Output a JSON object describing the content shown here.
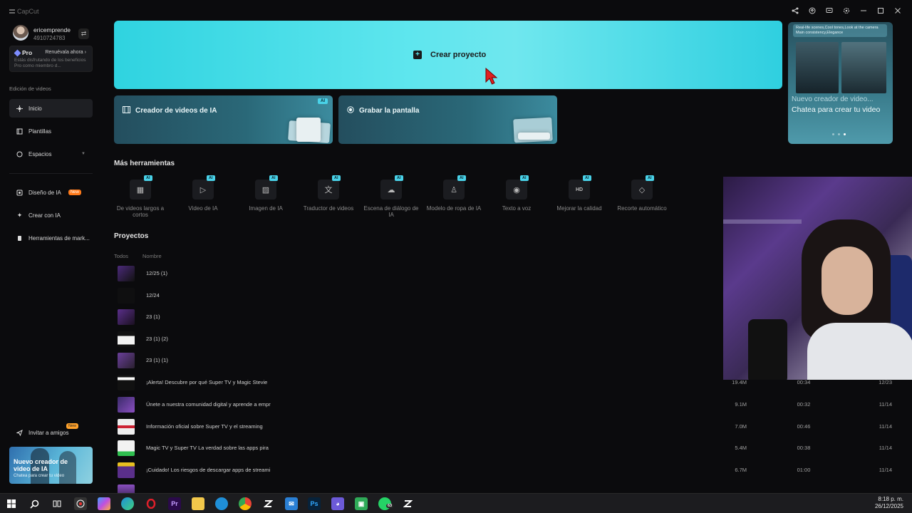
{
  "app": {
    "title": "CapCut"
  },
  "user": {
    "name": "ericemprende",
    "id": "4910724783"
  },
  "pro": {
    "badge": "Pro",
    "renew": "Renuévala ahora",
    "desc": "Estás disfrutando de los beneficios Pro como miembro d..."
  },
  "sidebar": {
    "section_label": "Edición de videos",
    "items": [
      {
        "label": "Inicio"
      },
      {
        "label": "Plantillas"
      },
      {
        "label": "Espacios"
      },
      {
        "label": "Diseño de IA",
        "tag": "New"
      },
      {
        "label": "Crear con IA"
      },
      {
        "label": "Herramientas de mark..."
      }
    ],
    "invite": {
      "label": "Invitar a amigos",
      "tag": "New"
    },
    "promo": {
      "title": "Nuevo creador de video de IA",
      "subtitle": "Chatea para crear tu video"
    }
  },
  "hero": {
    "label": "Crear proyecto"
  },
  "cards": [
    {
      "label": "Creador de videos de IA",
      "badge": "AI"
    },
    {
      "label": "Grabar la pantalla"
    }
  ],
  "side_promo": {
    "prompt": "Real-life scenes,Cool tones,Look at the camera Main consistency,Elegance",
    "title": "Nuevo creador de video...",
    "subtitle": "Chatea para crear tu video"
  },
  "tools": {
    "title": "Más herramientas",
    "items": [
      {
        "label": "De videos largos a cortos",
        "badge": "AI",
        "icon": "film-icon"
      },
      {
        "label": "Video de IA",
        "badge": "AI",
        "icon": "video-ai-icon"
      },
      {
        "label": "Imagen de IA",
        "badge": "AI",
        "icon": "image-ai-icon"
      },
      {
        "label": "Traductor de videos",
        "badge": "AI",
        "icon": "translate-icon"
      },
      {
        "label": "Escena de diálogo de IA",
        "badge": "AI",
        "icon": "dialogue-icon"
      },
      {
        "label": "Modelo de ropa de IA",
        "badge": "AI",
        "icon": "shirt-icon"
      },
      {
        "label": "Texto a voz",
        "badge": "AI",
        "icon": "voice-icon"
      },
      {
        "label": "Mejorar la calidad",
        "badge": "AI",
        "icon": "hd-icon"
      },
      {
        "label": "Recorte automático",
        "badge": "AI",
        "icon": "eraser-icon"
      }
    ]
  },
  "projects": {
    "title": "Proyectos",
    "columns": {
      "all": "Todos",
      "name": "Nombre"
    },
    "rows": [
      {
        "name": "12/25 (1)",
        "size": "",
        "duration": "",
        "date": ""
      },
      {
        "name": "12/24",
        "size": "",
        "duration": "",
        "date": ""
      },
      {
        "name": "23 (1)",
        "size": "",
        "duration": "",
        "date": ""
      },
      {
        "name": "23 (1) (2)",
        "size": "",
        "duration": "",
        "date": ""
      },
      {
        "name": "23 (1) (1)",
        "size": "",
        "duration": "",
        "date": ""
      },
      {
        "name": "¡Alerta! Descubre por qué Super TV y Magic Stevie",
        "size": "19.4M",
        "duration": "00:34",
        "date": "12/23"
      },
      {
        "name": "Únete a nuestra comunidad digital y aprende a empr",
        "size": "9.1M",
        "duration": "00:32",
        "date": "11/14"
      },
      {
        "name": "Información oficial sobre Super TV y el streaming",
        "size": "7.0M",
        "duration": "00:46",
        "date": "11/14"
      },
      {
        "name": "Magic TV y Super TV  La verdad sobre las apps pira",
        "size": "5.4M",
        "duration": "00:38",
        "date": "11/14"
      },
      {
        "name": "¡Cuidado! Los riesgos de descargar apps de streami",
        "size": "6.7M",
        "duration": "01:00",
        "date": "11/14"
      }
    ]
  },
  "taskbar": {
    "time": "8:18 p. m.",
    "date": "26/12/2025",
    "whatsapp_badge": "63"
  },
  "colors": {
    "accent": "#49d2e8",
    "hero": "#5fe6ee",
    "bg": "#0b0b0d"
  }
}
